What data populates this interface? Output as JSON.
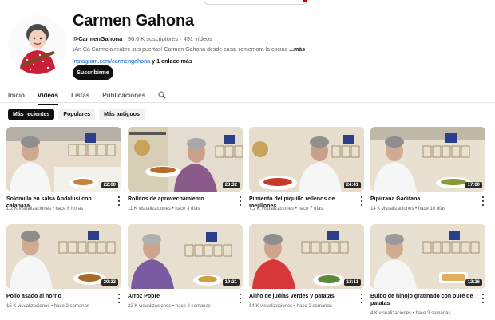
{
  "channel": {
    "name": "Carmen Gahona",
    "handle": "@CarmenGahona",
    "subscribers": "96,6 K suscriptores",
    "videos_count": "491 vídeos",
    "separator": "·",
    "description": "¡An Cá Carmela reabre sus puertas! Carmen Gahona desde casa, rememora la cocina",
    "description_more": "...más",
    "link": "instagram.com/carmengahona",
    "link_more": "y 1 enlace más",
    "subscribe_label": "Suscribirme"
  },
  "tabs": [
    {
      "label": "Inicio"
    },
    {
      "label": "Vídeos"
    },
    {
      "label": "Listas"
    },
    {
      "label": "Publicaciones"
    }
  ],
  "chips": [
    {
      "label": "Más recientes"
    },
    {
      "label": "Populares"
    },
    {
      "label": "Más antiguos"
    }
  ],
  "videos": [
    {
      "title": "Solomillo en salsa Andalusí con calabaza",
      "duration": "22:00",
      "stats": "1,2 K visualizaciones • hace 6 horas"
    },
    {
      "title": "Rollitos de aprovechamiento",
      "duration": "23:32",
      "stats": "11 K visualizaciones • hace 3 días"
    },
    {
      "title": "Pimiento del piquillo rellenos de mejillones",
      "duration": "24:41",
      "stats": "7,2 K visualizaciones • hace 7 días"
    },
    {
      "title": "Pipirrana Gaditana",
      "duration": "17:00",
      "stats": "14 K visualizaciones • hace 10 días"
    },
    {
      "title": "Pollo asado al horno",
      "duration": "20:32",
      "stats": "15 K visualizaciones • hace 2 semanas"
    },
    {
      "title": "Arroz Pobre",
      "duration": "19:21",
      "stats": "22 K visualizaciones • hace 2 semanas"
    },
    {
      "title": "Aliño de judías verdes y patatas",
      "duration": "13:11",
      "stats": "14 K visualizaciones • hace 2 semanas"
    },
    {
      "title": "Bulbo de hinojo gratinado con puré de patatas",
      "duration": "12:26",
      "stats": "4 K visualizaciones • hace 3 semanas"
    }
  ]
}
